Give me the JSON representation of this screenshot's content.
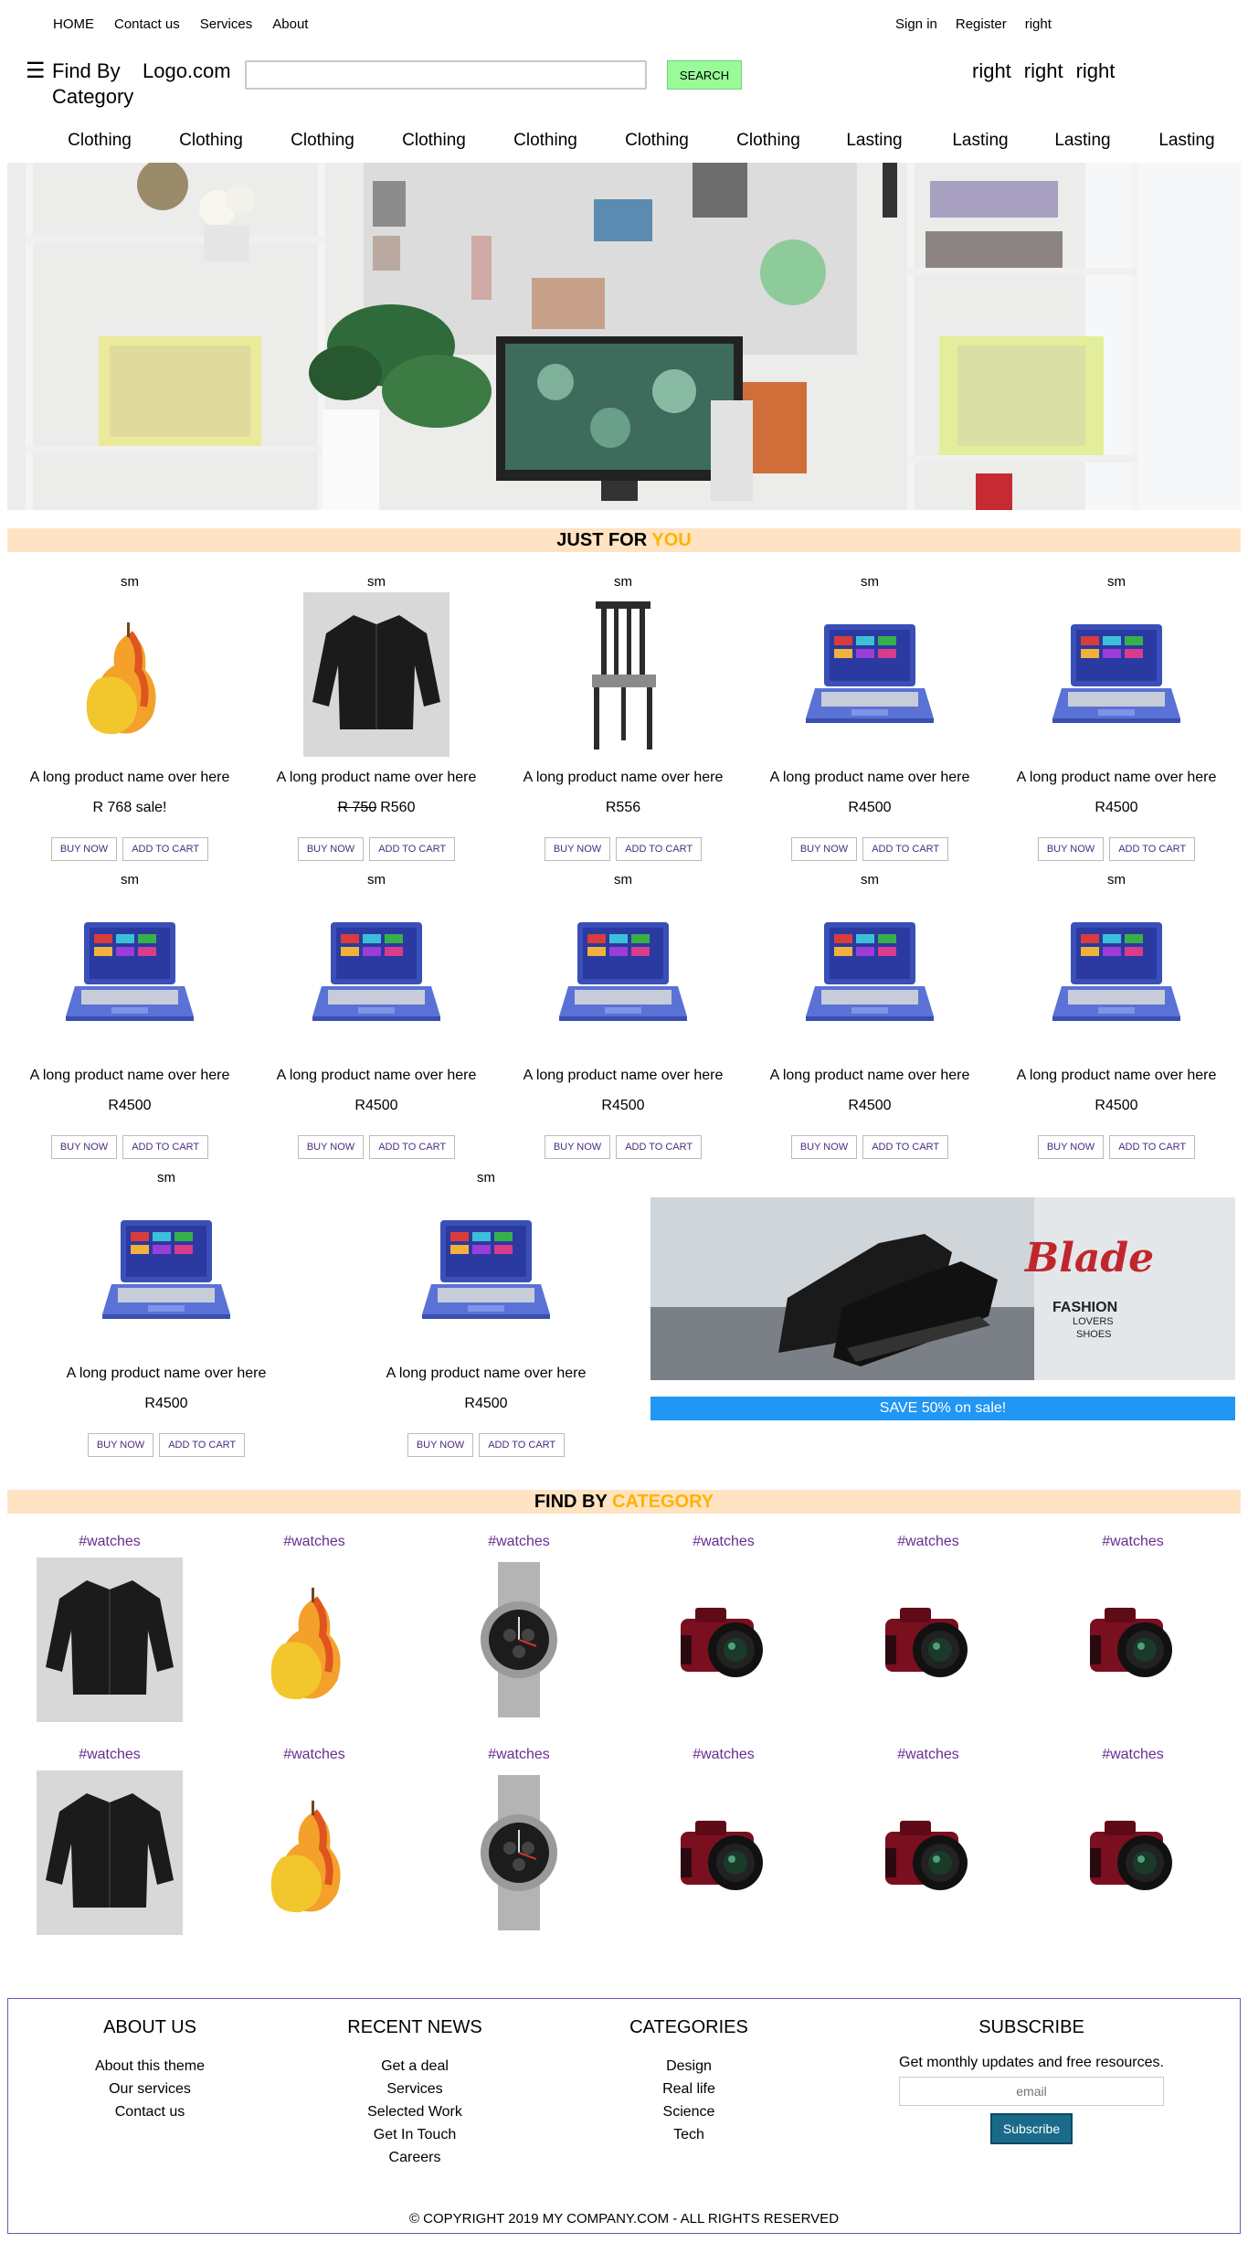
{
  "topnav": {
    "left": [
      "HOME",
      "Contact us",
      "Services",
      "About"
    ],
    "right": [
      "Sign in",
      "Register",
      "right"
    ]
  },
  "header": {
    "menu_icon": "☰",
    "find_by_category": "Find By Category",
    "logo": "Logo.com",
    "search_placeholder": "",
    "search_button": "SEARCH",
    "rights": [
      "right",
      "right",
      "right"
    ]
  },
  "categories": [
    "Clothing",
    "Clothing",
    "Clothing",
    "Clothing",
    "Clothing",
    "Clothing",
    "Clothing",
    "Lasting",
    "Lasting",
    "Lasting",
    "Lasting"
  ],
  "just_for_you": {
    "title": "JUST FOR ",
    "accent": "YOU"
  },
  "products": [
    {
      "top": "sm",
      "image": "pear",
      "name": "A long product name over here",
      "old_price": "",
      "price": "R 768 sale!",
      "buy": "BUY NOW",
      "cart": "ADD TO CART"
    },
    {
      "top": "sm",
      "image": "shirt",
      "name": "A long product name over here",
      "old_price": "R 750",
      "price": "R560",
      "buy": "BUY NOW",
      "cart": "ADD TO CART"
    },
    {
      "top": "sm",
      "image": "chair",
      "name": "A long product name over here",
      "old_price": "",
      "price": "R556",
      "buy": "BUY NOW",
      "cart": "ADD TO CART"
    },
    {
      "top": "sm",
      "image": "laptop",
      "name": "A long product name over here",
      "old_price": "",
      "price": "R4500",
      "buy": "BUY NOW",
      "cart": "ADD TO CART"
    },
    {
      "top": "sm",
      "image": "laptop",
      "name": "A long product name over here",
      "old_price": "",
      "price": "R4500",
      "buy": "BUY NOW",
      "cart": "ADD TO CART"
    },
    {
      "top": "sm",
      "image": "laptop",
      "name": "A long product name over here",
      "old_price": "",
      "price": "R4500",
      "buy": "BUY NOW",
      "cart": "ADD TO CART"
    },
    {
      "top": "sm",
      "image": "laptop",
      "name": "A long product name over here",
      "old_price": "",
      "price": "R4500",
      "buy": "BUY NOW",
      "cart": "ADD TO CART"
    },
    {
      "top": "sm",
      "image": "laptop",
      "name": "A long product name over here",
      "old_price": "",
      "price": "R4500",
      "buy": "BUY NOW",
      "cart": "ADD TO CART"
    },
    {
      "top": "sm",
      "image": "laptop",
      "name": "A long product name over here",
      "old_price": "",
      "price": "R4500",
      "buy": "BUY NOW",
      "cart": "ADD TO CART"
    },
    {
      "top": "sm",
      "image": "laptop",
      "name": "A long product name over here",
      "old_price": "",
      "price": "R4500",
      "buy": "BUY NOW",
      "cart": "ADD TO CART"
    },
    {
      "top": "sm",
      "image": "laptop",
      "name": "A long product name over here",
      "old_price": "",
      "price": "R4500",
      "buy": "BUY NOW",
      "cart": "ADD TO CART"
    },
    {
      "top": "sm",
      "image": "laptop",
      "name": "A long product name over here",
      "old_price": "",
      "price": "R4500",
      "buy": "BUY NOW",
      "cart": "ADD TO CART"
    }
  ],
  "promo": {
    "brand": "Blade",
    "line1": "FASHION",
    "line2": "LOVERS",
    "line3": "SHOES",
    "sale": "SAVE 50% on sale!"
  },
  "find_by_category": {
    "title": "FIND BY ",
    "accent": "CATEGORY"
  },
  "category_items": [
    {
      "tag": "#watches",
      "image": "shirt"
    },
    {
      "tag": "#watches",
      "image": "pear"
    },
    {
      "tag": "#watches",
      "image": "watch"
    },
    {
      "tag": "#watches",
      "image": "camera"
    },
    {
      "tag": "#watches",
      "image": "camera"
    },
    {
      "tag": "#watches",
      "image": "camera"
    },
    {
      "tag": "#watches",
      "image": "shirt"
    },
    {
      "tag": "#watches",
      "image": "pear"
    },
    {
      "tag": "#watches",
      "image": "watch"
    },
    {
      "tag": "#watches",
      "image": "camera"
    },
    {
      "tag": "#watches",
      "image": "camera"
    },
    {
      "tag": "#watches",
      "image": "camera"
    }
  ],
  "footer": {
    "about": {
      "title": "ABOUT US",
      "links": [
        "About this theme",
        "Our services",
        "Contact us"
      ]
    },
    "news": {
      "title": "RECENT NEWS",
      "links": [
        "Get a deal",
        "Services",
        "Selected Work",
        "Get In Touch",
        "Careers"
      ]
    },
    "categories": {
      "title": "CATEGORIES",
      "links": [
        "Design",
        "Real life",
        "Science",
        "Tech"
      ]
    },
    "subscribe": {
      "title": "SUBSCRIBE",
      "text": "Get monthly updates and free resources.",
      "placeholder": "email",
      "button": "Subscribe"
    },
    "copyright": "© COPYRIGHT 2019 MY COMPANY.COM - ALL RIGHTS RESERVED"
  }
}
